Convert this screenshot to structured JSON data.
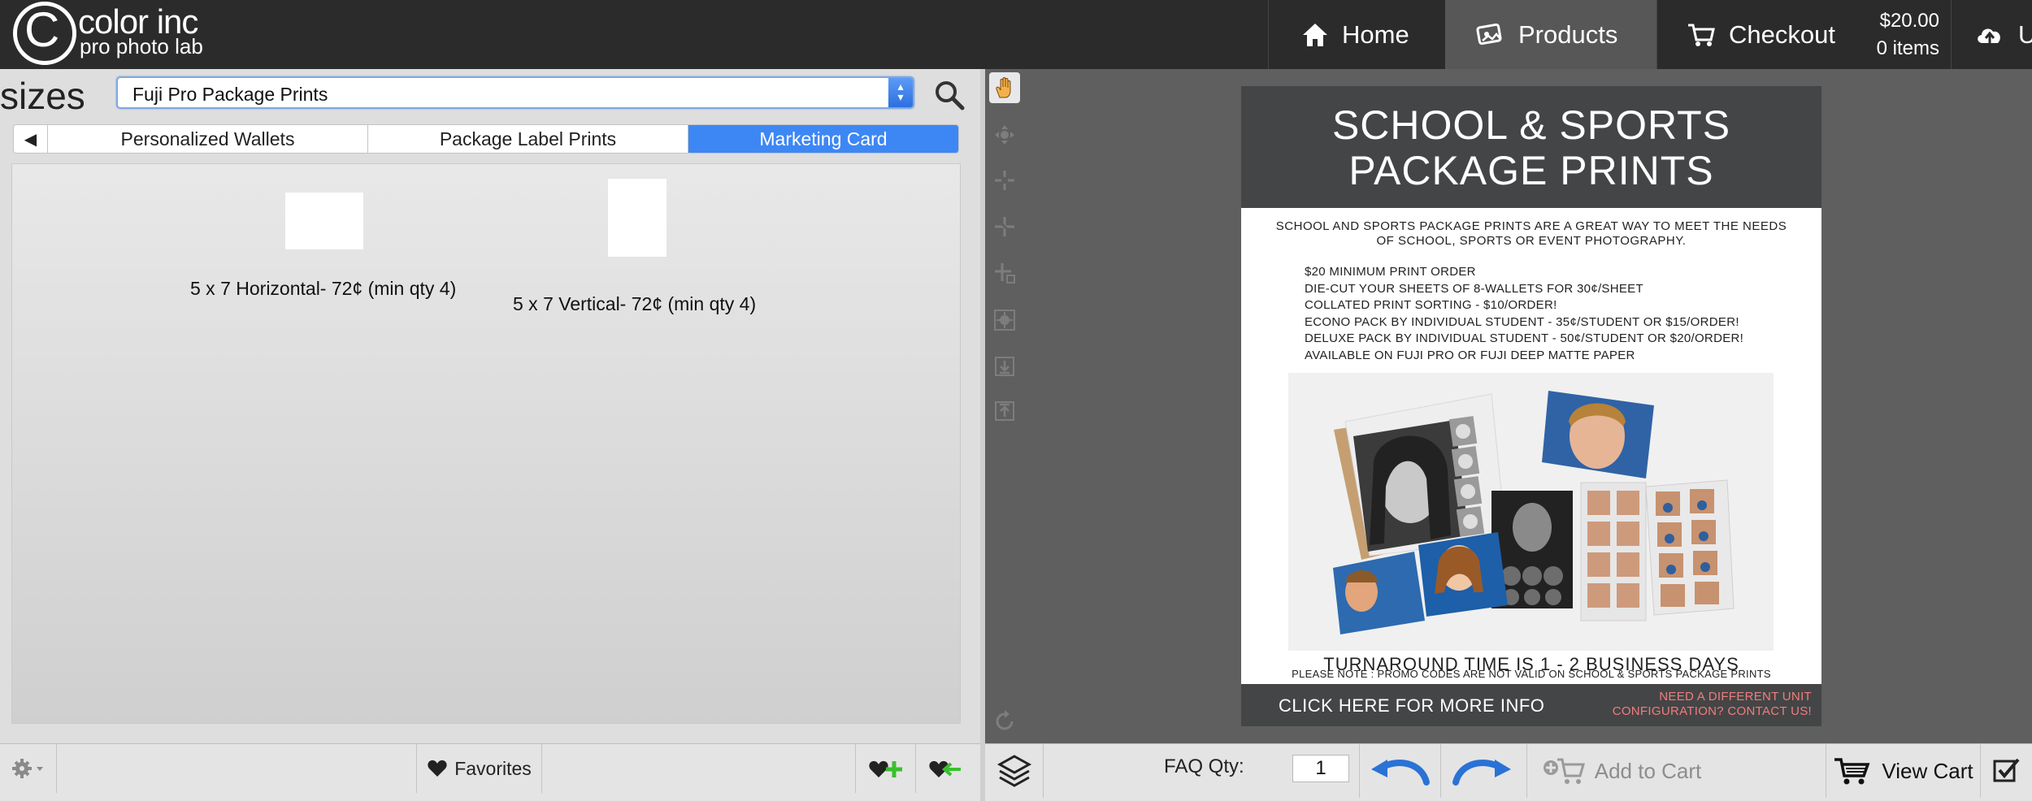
{
  "brand": {
    "name": "color inc",
    "tagline": "pro photo lab",
    "logo_letter": "C"
  },
  "nav": {
    "home": "Home",
    "products": "Products",
    "checkout": "Checkout",
    "cart_total": "$20.00",
    "cart_items": "0 items",
    "upload": "U"
  },
  "left_panel": {
    "sizes_label": "sizes",
    "product_line": "Fuji Pro Package Prints",
    "tabs": [
      "Personalized Wallets",
      "Package Label Prints",
      "Marketing Card"
    ],
    "active_tab": "Marketing Card",
    "products": [
      {
        "label": "5 x 7 Horizontal-  72¢ (min qty 4)",
        "orientation": "horizontal"
      },
      {
        "label": "5 x 7 Vertical- 72¢ (min qty 4)",
        "orientation": "vertical"
      }
    ],
    "favorites_label": "Favorites"
  },
  "card": {
    "title_line1": "SCHOOL & SPORTS",
    "title_line2": "PACKAGE PRINTS",
    "intro": "SCHOOL AND SPORTS PACKAGE PRINTS ARE A GREAT WAY TO MEET THE NEEDS OF SCHOOL, SPORTS OR EVENT PHOTOGRAPHY.",
    "bullets": [
      "$20 MINIMUM PRINT ORDER",
      "DIE-CUT YOUR SHEETS OF 8-WALLETS FOR 30¢/SHEET",
      "COLLATED PRINT SORTING - $10/ORDER!",
      "ECONO PACK BY INDIVIDUAL STUDENT - 35¢/STUDENT OR $15/ORDER!",
      "DELUXE PACK BY INDIVIDUAL STUDENT - 50¢/STUDENT OR $20/ORDER!",
      "AVAILABLE ON FUJI PRO OR FUJI DEEP MATTE PAPER"
    ],
    "turnaround": "TURNAROUND TIME IS 1 - 2 BUSINESS DAYS",
    "promo_note": "PLEASE NOTE : PROMO CODES ARE NOT VALID ON SCHOOL & SPORTS PACKAGE PRINTS",
    "footer_click": "CLICK",
    "footer_here": "HERE",
    "footer_more": "FOR MORE INFO",
    "footer_contact_1": "NEED A DIFFERENT UNIT",
    "footer_contact_2": "CONFIGURATION? CONTACT US!"
  },
  "bottom_bar": {
    "qty_label": "FAQ Qty:",
    "qty_value": "1",
    "add_to_cart": "Add to Cart",
    "view_cart": "View Cart"
  },
  "colors": {
    "topbar": "#2b2b2b",
    "active_tab": "#3d87f5",
    "canvas_bg": "#5f5f5f",
    "card_header": "#444546",
    "contact_text": "#f07d7d",
    "arrow_blue": "#2a72d6",
    "fav_green": "#3bbf2e"
  }
}
